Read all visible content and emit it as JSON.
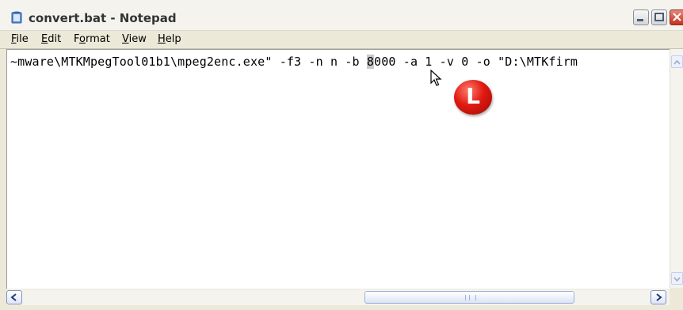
{
  "window": {
    "title": "convert.bat - Notepad"
  },
  "menu": [
    {
      "mnemonic": "F",
      "rest": "ile"
    },
    {
      "mnemonic": "E",
      "rest": "dit"
    },
    {
      "pre": "F",
      "mnemonic": "o",
      "rest": "rmat"
    },
    {
      "mnemonic": "V",
      "rest": "iew"
    },
    {
      "mnemonic": "H",
      "rest": "elp"
    }
  ],
  "editor": {
    "line_before": "~mware\\MTKMpegTool01b1\\mpeg2enc.exe\" -f3 -n n -b ",
    "selected": "8",
    "line_after": "000 -a 1 -v 0 -o \"D:\\MTKfirm"
  },
  "annotation": {
    "badge_letter": "L"
  },
  "colors": {
    "badge": "#e01a12",
    "close_button": "#c6321c"
  },
  "icons": [
    "notepad-icon",
    "minimize-icon",
    "maximize-icon",
    "close-icon",
    "scroll-up-icon",
    "scroll-down-icon",
    "scroll-left-icon",
    "scroll-right-icon",
    "mouse-pointer-icon"
  ]
}
